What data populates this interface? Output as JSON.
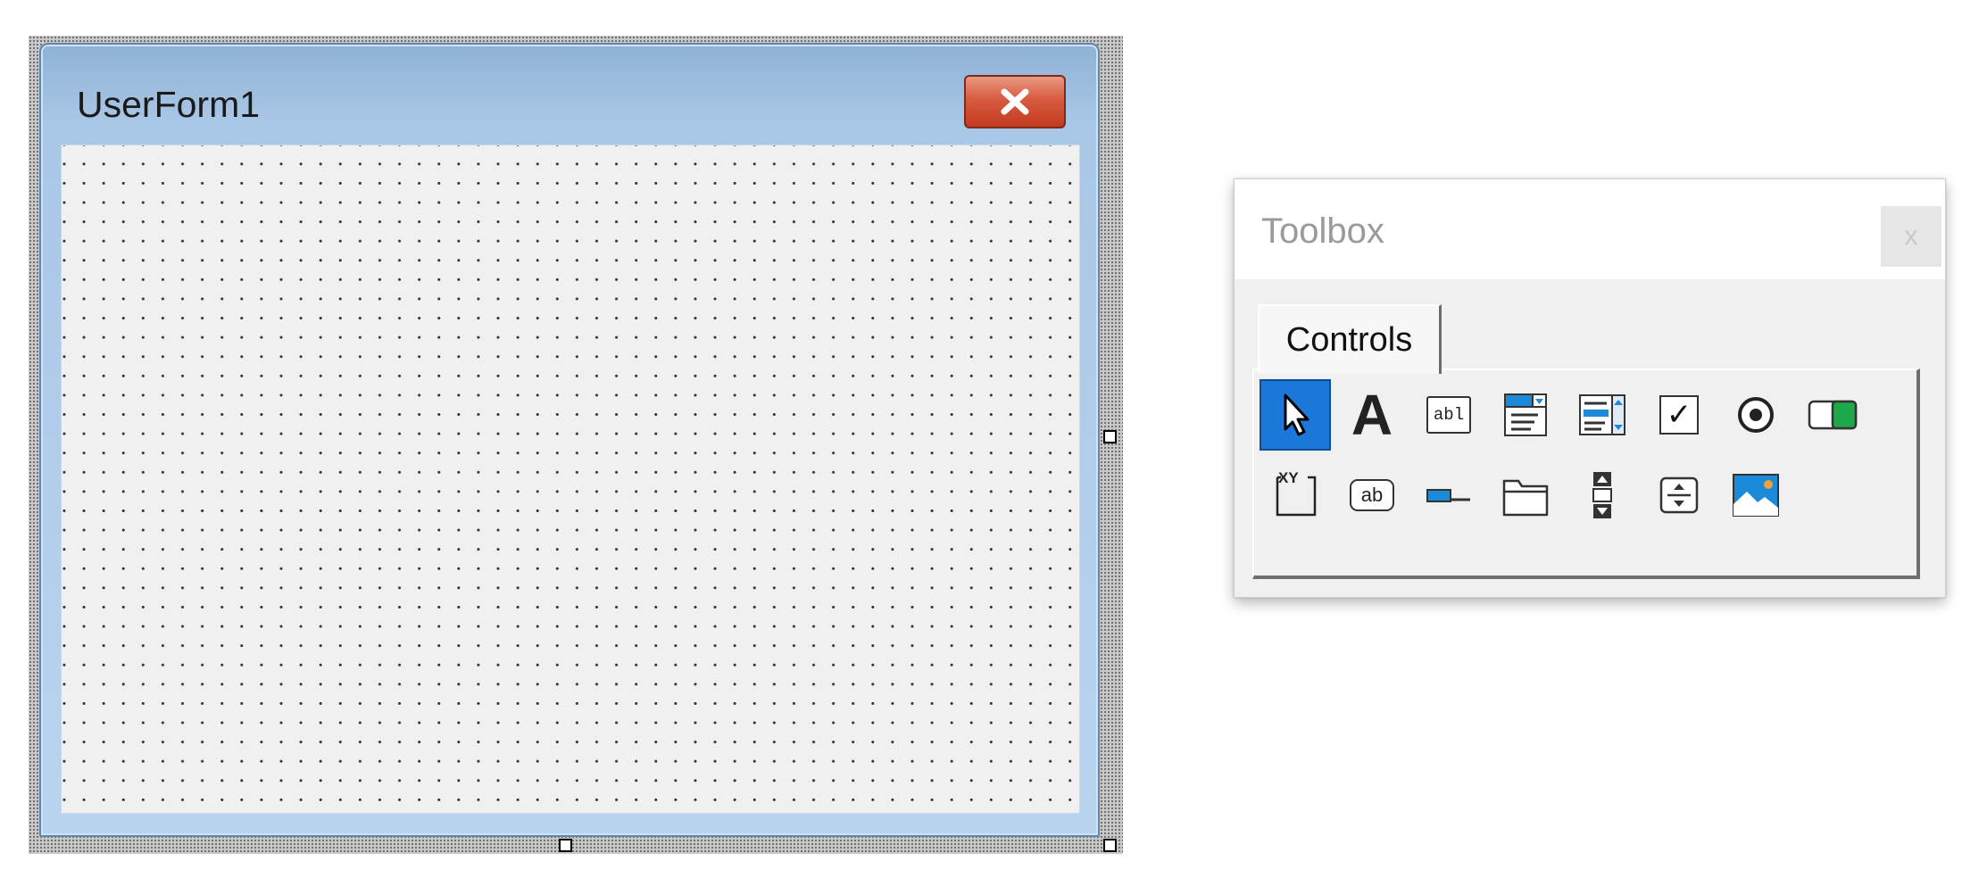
{
  "userform": {
    "title": "UserForm1",
    "close_icon": "close-icon"
  },
  "toolbox": {
    "title": "Toolbox",
    "close_glyph": "x",
    "tabs": [
      {
        "label": "Controls"
      }
    ],
    "row1": [
      {
        "name": "select-objects-icon",
        "selected": true
      },
      {
        "name": "label-icon",
        "glyph": "A"
      },
      {
        "name": "textbox-icon",
        "glyph": "abl"
      },
      {
        "name": "combobox-icon"
      },
      {
        "name": "listbox-icon"
      },
      {
        "name": "checkbox-icon",
        "glyph": "✓"
      },
      {
        "name": "option-button-icon"
      },
      {
        "name": "toggle-button-icon"
      }
    ],
    "row2": [
      {
        "name": "frame-icon",
        "glyph": "XY"
      },
      {
        "name": "command-button-icon",
        "glyph": "ab"
      },
      {
        "name": "tabstrip-icon"
      },
      {
        "name": "multipage-icon"
      },
      {
        "name": "scrollbar-icon"
      },
      {
        "name": "spin-button-icon"
      },
      {
        "name": "image-icon"
      }
    ]
  },
  "colors": {
    "selected_tool": "#1b78d8",
    "form_title_bar": "#a9c7e6",
    "close_button": "#d75b3f"
  }
}
